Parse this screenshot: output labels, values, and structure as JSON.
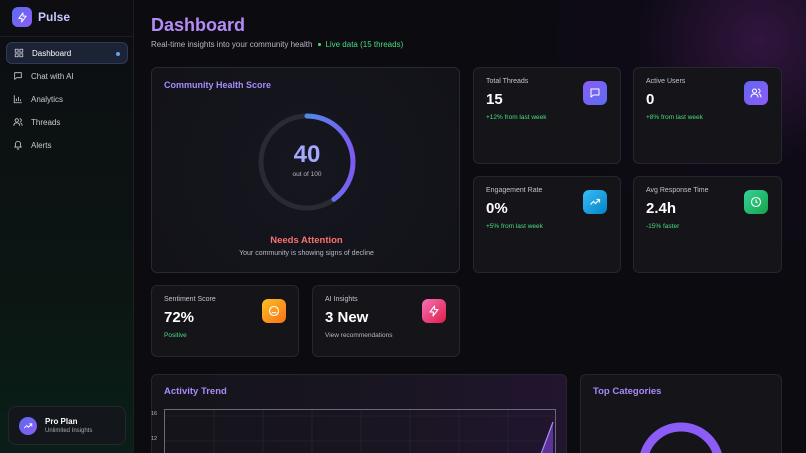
{
  "brand": {
    "name": "Pulse"
  },
  "nav": [
    {
      "label": "Dashboard",
      "icon": "grid-icon",
      "active": true
    },
    {
      "label": "Chat with AI",
      "icon": "chat-icon",
      "active": false
    },
    {
      "label": "Analytics",
      "icon": "bar-chart-icon",
      "active": false
    },
    {
      "label": "Threads",
      "icon": "users-icon",
      "active": false
    },
    {
      "label": "Alerts",
      "icon": "bell-icon",
      "active": false
    }
  ],
  "plan": {
    "title": "Pro Plan",
    "subtitle": "Unlimited Insights"
  },
  "header": {
    "title": "Dashboard",
    "subtitle": "Real-time insights into your community health",
    "live": "Live data (15 threads)"
  },
  "health": {
    "title": "Community Health Score",
    "score": "40",
    "score_value": 40,
    "out_of": "out of 100",
    "status": "Needs Attention",
    "description": "Your community is showing signs of decline"
  },
  "stats": {
    "total_threads": {
      "title": "Total Threads",
      "value": "15",
      "trend": "+12% from last week",
      "icon": "message-icon"
    },
    "active_users": {
      "title": "Active Users",
      "value": "0",
      "trend": "+8% from last week",
      "icon": "users-icon"
    },
    "engagement": {
      "title": "Engagement Rate",
      "value": "0%",
      "trend": "+5% from last week",
      "icon": "trending-up-icon"
    },
    "response_time": {
      "title": "Avg Response Time",
      "value": "2.4h",
      "trend": "-15% faster",
      "icon": "clock-icon"
    },
    "sentiment": {
      "title": "Sentiment Score",
      "value": "72%",
      "trend": "Positive",
      "icon": "smile-icon"
    },
    "ai_insights": {
      "title": "AI Insights",
      "value": "3 New",
      "trend": "View recommendations",
      "icon": "zap-icon"
    }
  },
  "activity": {
    "title": "Activity Trend",
    "ticks": [
      "16",
      "12"
    ]
  },
  "categories": {
    "title": "Top Categories"
  },
  "colors": {
    "accent": "#a78bfa",
    "live": "#4ade80",
    "danger": "#f87171",
    "threads_icon": "#7c3aed",
    "users_icon": "#6366f1",
    "engagement_icon": "#0ea5e9",
    "response_icon": "#22c55e",
    "sentiment_icon": "#f59e0b",
    "ai_icon": "#ec4899"
  }
}
